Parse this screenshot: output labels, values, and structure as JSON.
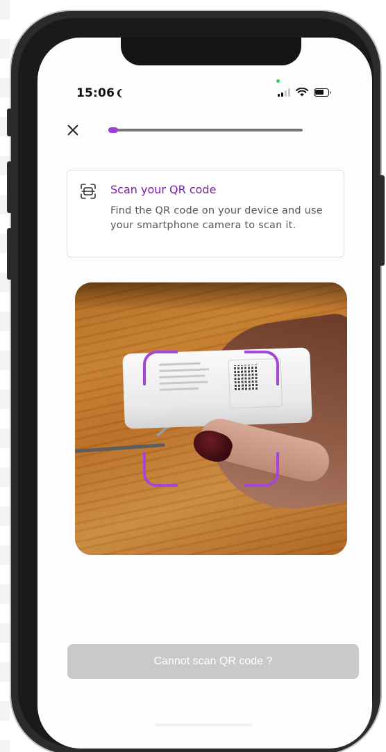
{
  "status_bar": {
    "time": "15:06",
    "icons": [
      "moon-icon",
      "signal-icon",
      "wifi-icon",
      "battery-icon"
    ]
  },
  "header": {
    "close_icon": "close-icon",
    "progress": 0.05
  },
  "info_card": {
    "icon": "qr-scan-icon",
    "title": "Scan your QR code",
    "description": "Find the QR code on your device and use your smartphone camera to scan it."
  },
  "camera": {
    "reticle_color": "#a646d8"
  },
  "footer": {
    "cannot_scan_label": "Cannot scan QR code ?"
  },
  "colors": {
    "accent": "#9b3fd9",
    "title": "#7a1fa8",
    "button_disabled": "#c9c9c9"
  }
}
